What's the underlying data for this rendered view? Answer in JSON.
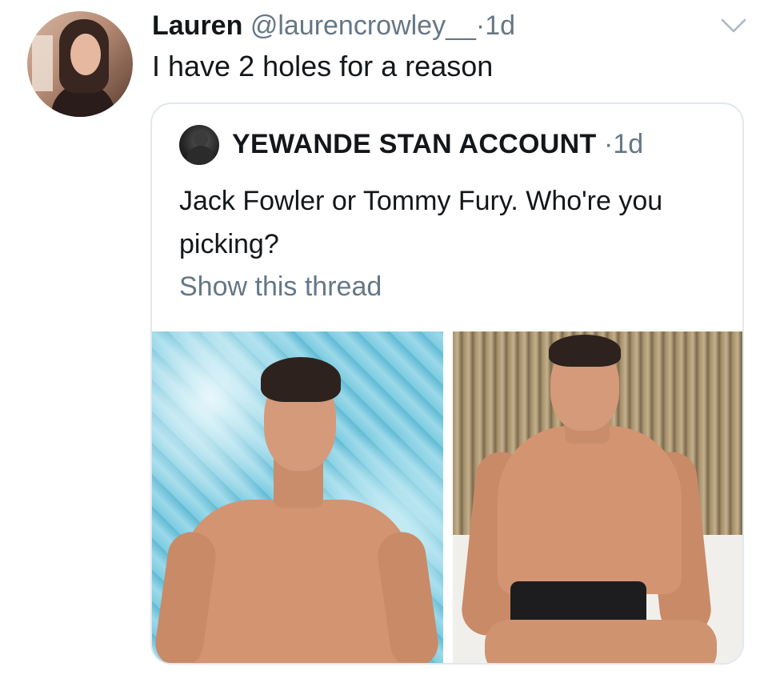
{
  "tweet": {
    "name": "Lauren",
    "handle": "@laurencrowley__",
    "dot": "·",
    "time": "1d",
    "text": "I have 2 holes for a reason",
    "menu_icon": "chevron-down-icon"
  },
  "quoted_tweet": {
    "name": "YEWANDE STAN ACCOUNT",
    "dot": "·",
    "time": "1d",
    "text": "Jack Fowler or Tommy Fury. Who're you picking?",
    "show_thread": "Show this thread",
    "media": [
      {
        "description_icon": "photo-man-pool-background"
      },
      {
        "description_icon": "photo-man-seated"
      }
    ]
  },
  "colors": {
    "text_primary": "#14171a",
    "text_secondary": "#657786",
    "border": "#e1e8ed",
    "background": "#ffffff"
  }
}
